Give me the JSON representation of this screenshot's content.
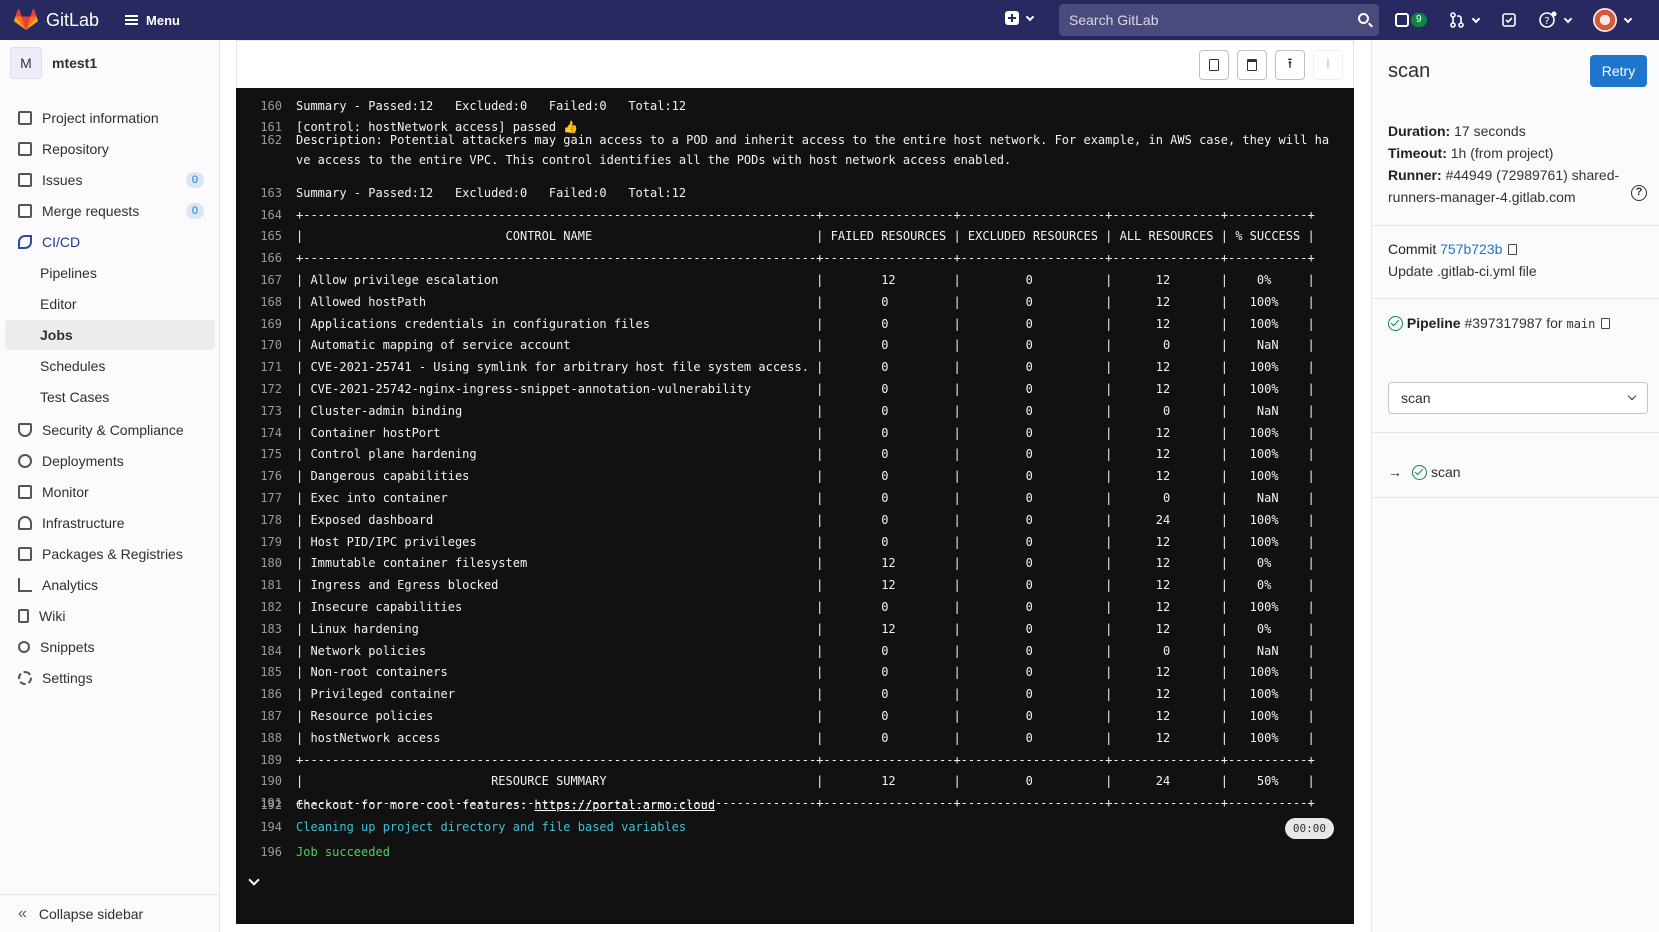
{
  "topbar": {
    "brand": "GitLab",
    "menu_label": "Menu",
    "search_placeholder": "Search GitLab",
    "issues_count": "9"
  },
  "sidebar": {
    "project_initial": "M",
    "project_name": "mtest1",
    "items": [
      {
        "label": "Project information",
        "icon": "info-icon"
      },
      {
        "label": "Repository",
        "icon": "doc-icon"
      },
      {
        "label": "Issues",
        "icon": "issues-icon",
        "count": "0"
      },
      {
        "label": "Merge requests",
        "icon": "merge-request-icon",
        "count": "0"
      },
      {
        "label": "CI/CD",
        "icon": "rocket-icon"
      }
    ],
    "cicd_sub": [
      "Pipelines",
      "Editor",
      "Jobs",
      "Schedules",
      "Test Cases"
    ],
    "items2": [
      {
        "label": "Security & Compliance",
        "icon": "shield-icon"
      },
      {
        "label": "Deployments",
        "icon": "deployments-icon"
      },
      {
        "label": "Monitor",
        "icon": "monitor-icon"
      },
      {
        "label": "Infrastructure",
        "icon": "cloud-icon"
      },
      {
        "label": "Packages & Registries",
        "icon": "package-icon"
      },
      {
        "label": "Analytics",
        "icon": "chart-icon"
      },
      {
        "label": "Wiki",
        "icon": "book-icon"
      },
      {
        "label": "Snippets",
        "icon": "scissors-icon"
      },
      {
        "label": "Settings",
        "icon": "gear-icon"
      }
    ],
    "collapse_label": "Collapse sidebar"
  },
  "log": {
    "lines": [
      {
        "n": "160",
        "t": "Summary - Passed:12   Excluded:0   Failed:0   Total:12"
      },
      {
        "n": "161",
        "t": "[control: hostNetwork access] passed 👍"
      },
      {
        "n": "163",
        "t": "Summary - Passed:12   Excluded:0   Failed:0   Total:12"
      },
      {
        "n": "164",
        "t": "+-----------------------------------------------------------------------+------------------+--------------------+---------------+-----------+"
      },
      {
        "n": "165",
        "t": "|                            CONTROL NAME                               | FAILED RESOURCES | EXCLUDED RESOURCES | ALL RESOURCES | % SUCCESS |"
      },
      {
        "n": "166",
        "t": "+-----------------------------------------------------------------------+------------------+--------------------+---------------+-----------+"
      },
      {
        "n": "167",
        "t": "| Allow privilege escalation                                            |        12        |         0          |      12       |    0%     |"
      },
      {
        "n": "168",
        "t": "| Allowed hostPath                                                      |        0         |         0          |      12       |   100%    |"
      },
      {
        "n": "169",
        "t": "| Applications credentials in configuration files                       |        0         |         0          |      12       |   100%    |"
      },
      {
        "n": "170",
        "t": "| Automatic mapping of service account                                  |        0         |         0          |       0       |    NaN    |"
      },
      {
        "n": "171",
        "t": "| CVE-2021-25741 - Using symlink for arbitrary host file system access. |        0         |         0          |      12       |   100%    |"
      },
      {
        "n": "172",
        "t": "| CVE-2021-25742-nginx-ingress-snippet-annotation-vulnerability         |        0         |         0          |      12       |   100%    |"
      },
      {
        "n": "173",
        "t": "| Cluster-admin binding                                                 |        0         |         0          |       0       |    NaN    |"
      },
      {
        "n": "174",
        "t": "| Container hostPort                                                    |        0         |         0          |      12       |   100%    |"
      },
      {
        "n": "175",
        "t": "| Control plane hardening                                               |        0         |         0          |      12       |   100%    |"
      },
      {
        "n": "176",
        "t": "| Dangerous capabilities                                                |        0         |         0          |      12       |   100%    |"
      },
      {
        "n": "177",
        "t": "| Exec into container                                                   |        0         |         0          |       0       |    NaN    |"
      },
      {
        "n": "178",
        "t": "| Exposed dashboard                                                     |        0         |         0          |      24       |   100%    |"
      },
      {
        "n": "179",
        "t": "| Host PID/IPC privileges                                               |        0         |         0          |      12       |   100%    |"
      },
      {
        "n": "180",
        "t": "| Immutable container filesystem                                        |        12        |         0          |      12       |    0%     |"
      },
      {
        "n": "181",
        "t": "| Ingress and Egress blocked                                            |        12        |         0          |      12       |    0%     |"
      },
      {
        "n": "182",
        "t": "| Insecure capabilities                                                 |        0         |         0          |      12       |   100%    |"
      },
      {
        "n": "183",
        "t": "| Linux hardening                                                       |        12        |         0          |      12       |    0%     |"
      },
      {
        "n": "184",
        "t": "| Network policies                                                      |        0         |         0          |       0       |    NaN    |"
      },
      {
        "n": "185",
        "t": "| Non-root containers                                                   |        0         |         0          |      12       |   100%    |"
      },
      {
        "n": "186",
        "t": "| Privileged container                                                  |        0         |         0          |      12       |   100%    |"
      },
      {
        "n": "187",
        "t": "| Resource policies                                                     |        0         |         0          |      12       |   100%    |"
      },
      {
        "n": "188",
        "t": "| hostNetwork access                                                    |        0         |         0          |      12       |   100%    |"
      },
      {
        "n": "189",
        "t": "+-----------------------------------------------------------------------+------------------+--------------------+---------------+-----------+"
      },
      {
        "n": "190",
        "t": "|                          RESOURCE SUMMARY                             |        12        |         0          |      24       |    50%    |"
      },
      {
        "n": "191",
        "t": "+-----------------------------------------------------------------------+------------------+--------------------+---------------+-----------+"
      }
    ],
    "line162_num": "162",
    "line162_text": "Description: Potential attackers may gain access to a POD and inherit access to the entire host network. For example, in AWS case, they will have access to the entire VPC. This control identifies all the PODs with host network access enabled.",
    "line192_num": "192",
    "line192_prefix": "Checkout for more cool features: ",
    "line192_link": "https://portal.armo.cloud",
    "line194_num": "194",
    "line194_text": "Cleaning up project directory and file based variables",
    "line196_num": "196",
    "line196_text": "Job succeeded",
    "timer": "00:00"
  },
  "job": {
    "title": "scan",
    "retry_label": "Retry",
    "duration_label": "Duration:",
    "duration": "17 seconds",
    "timeout_label": "Timeout:",
    "timeout": "1h (from project)",
    "runner_label": "Runner:",
    "runner": "#44949 (72989761) shared-runners-manager-4.gitlab.com",
    "commit_label": "Commit",
    "commit_sha": "757b723b",
    "commit_message": "Update .gitlab-ci.yml file",
    "pipeline_label": "Pipeline",
    "pipeline_id": "#397317987",
    "pipeline_for": "for",
    "pipeline_branch": "main",
    "stage_select": "scan",
    "job_name": "scan"
  },
  "colors": {
    "topbar": "#292961",
    "accent": "#1f75cb",
    "success": "#108548",
    "log_bg": "#111111"
  }
}
